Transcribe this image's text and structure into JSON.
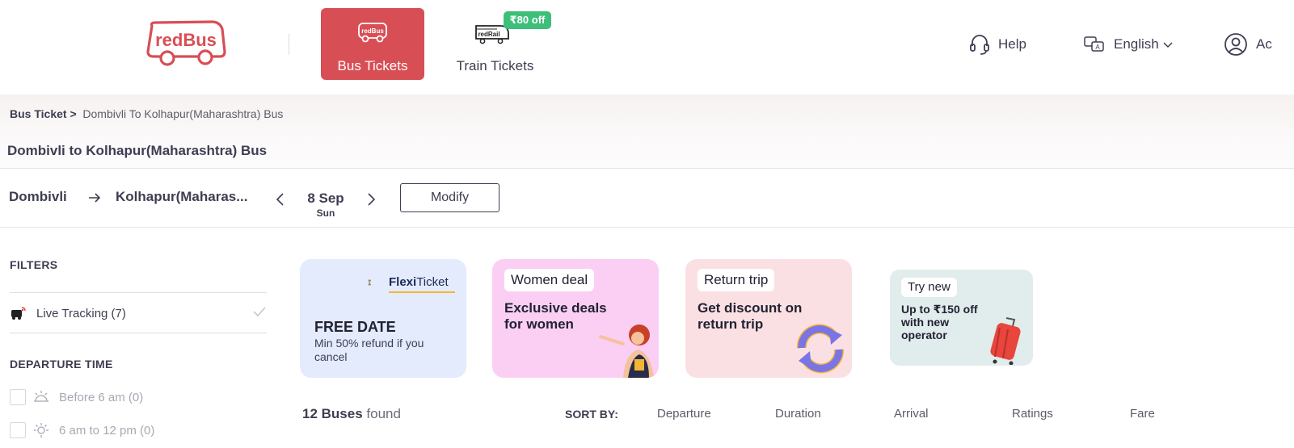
{
  "header": {
    "logo_text": "redBus",
    "nav": {
      "bus_tickets": "Bus Tickets",
      "bus_icon_text": "redBus",
      "train_tickets": "Train Tickets",
      "train_icon_text": "redRail",
      "train_offer_badge": "₹80 off"
    },
    "help": "Help",
    "language": "English",
    "account": "Ac"
  },
  "breadcrumb": {
    "root": "Bus Ticket",
    "separator": ">",
    "current": "Dombivli To Kolhapur(Maharashtra) Bus"
  },
  "page_title": "Dombivli to Kolhapur(Maharashtra) Bus",
  "search": {
    "source": "Dombivli",
    "destination": "Kolhapur(Maharas...",
    "date": "8 Sep",
    "weekday": "Sun",
    "modify_label": "Modify"
  },
  "filters": {
    "title": "FILTERS",
    "live_tracking": "Live Tracking (7)",
    "departure_title": "DEPARTURE TIME",
    "departure_options": [
      "Before 6 am (0)",
      "6 am to 12 pm (0)"
    ]
  },
  "offers": {
    "flexi": {
      "logo_bold": "Flexi",
      "logo_rest": "Ticket",
      "heading": "FREE DATE",
      "sub": "Min 50% refund if you cancel"
    },
    "women": {
      "tag": "Women deal",
      "heading": "Exclusive deals for women"
    },
    "return": {
      "tag": "Return trip",
      "heading": "Get discount on return trip"
    },
    "try_new": {
      "tag": "Try new",
      "heading": "Up to ₹150 off with new operator"
    }
  },
  "results": {
    "count": "12 Buses",
    "found": "found",
    "sort_by": "SORT BY:",
    "sort_options": [
      "Departure",
      "Duration",
      "Arrival",
      "Ratings",
      "Fare"
    ]
  },
  "colors": {
    "brand": "#d84e55",
    "offer_green": "#3dbf7a",
    "text_dark": "#3e3e52"
  }
}
